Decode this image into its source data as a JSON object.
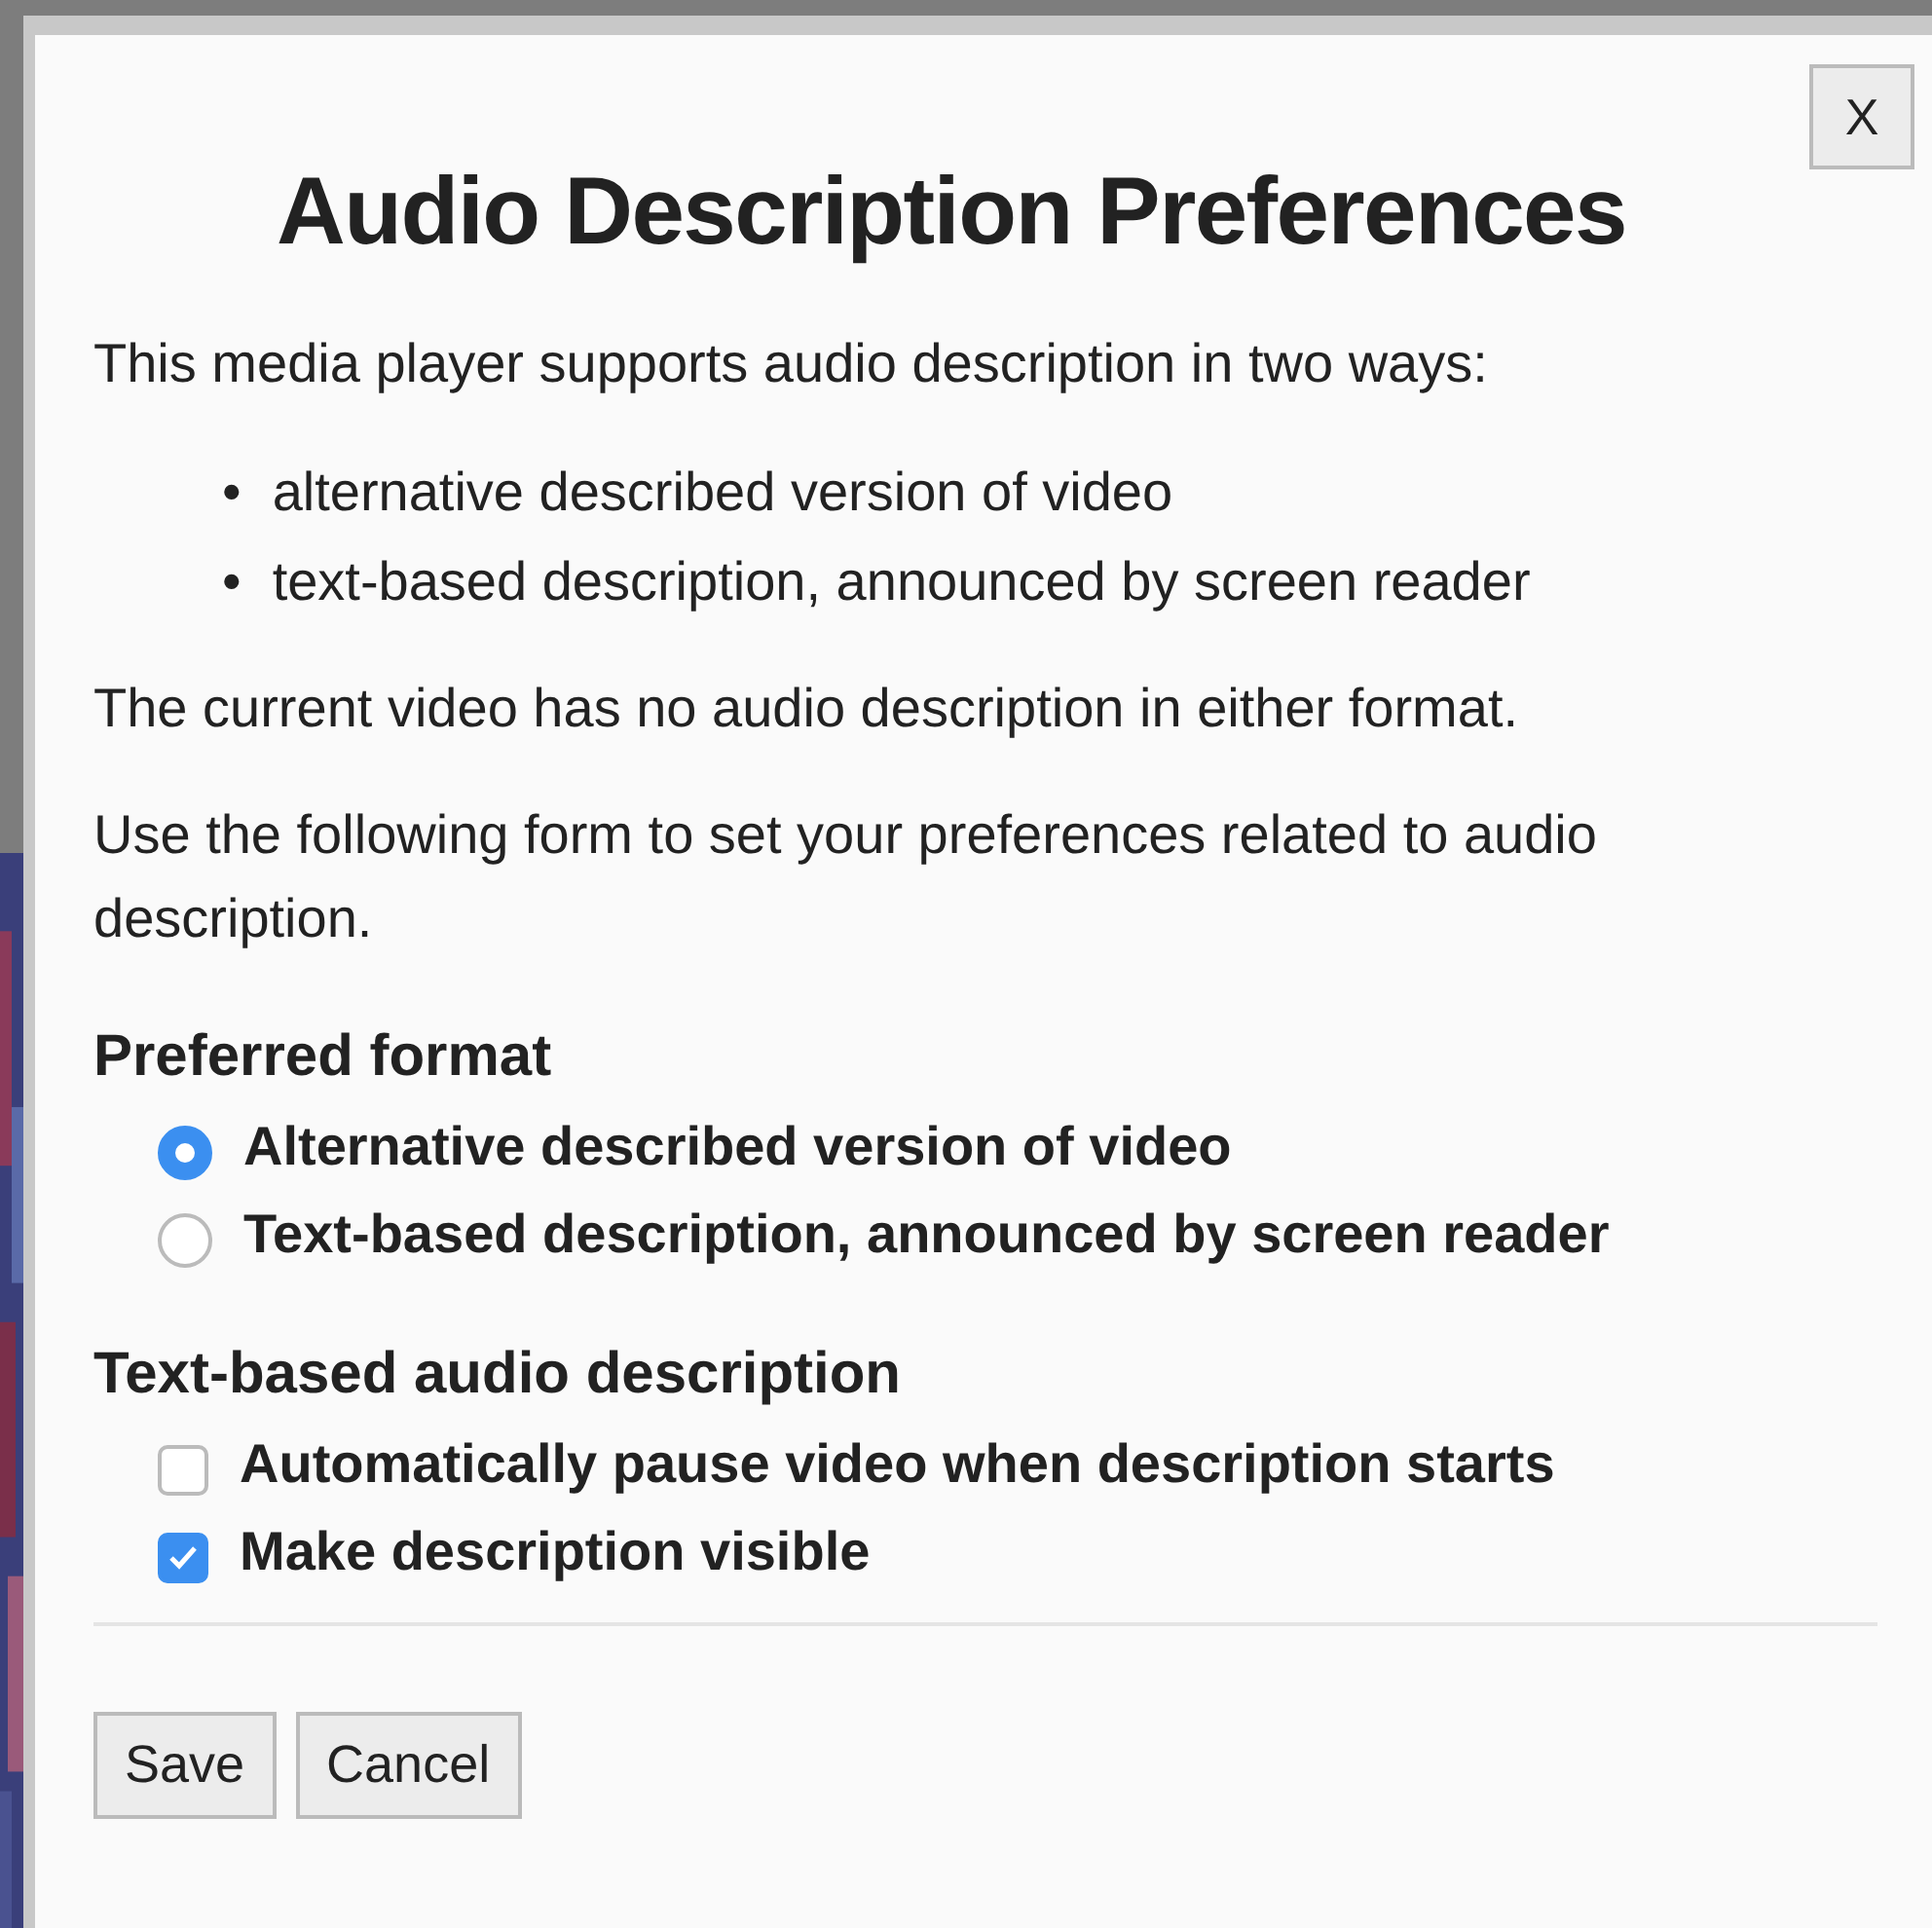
{
  "dialog": {
    "close_button": "X",
    "title": "Audio Description Preferences",
    "intro": "This media player supports audio description in two ways:",
    "ways": [
      {
        "marker": "•",
        "text": "alternative described version of video"
      },
      {
        "marker": "•",
        "text": "text-based description, announced by screen reader"
      }
    ],
    "status": "The current video has no audio description in either format.",
    "instructions": "Use the following form to set your preferences related to audio description.",
    "sections": [
      {
        "heading": "Preferred format",
        "options": [
          {
            "kind": "radio",
            "label": "Alternative described version of video",
            "selected": true
          },
          {
            "kind": "radio",
            "label": "Text-based description, announced by screen reader",
            "selected": false
          }
        ]
      },
      {
        "heading": "Text-based audio description",
        "options": [
          {
            "kind": "checkbox",
            "label": "Automatically pause video when description starts",
            "checked": false
          },
          {
            "kind": "checkbox",
            "label": "Make description visible",
            "checked": true
          }
        ]
      }
    ],
    "buttons": [
      "Save",
      "Cancel"
    ]
  }
}
